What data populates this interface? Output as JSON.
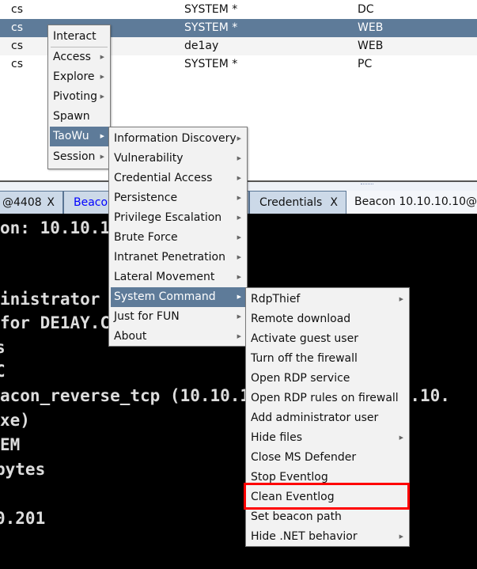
{
  "table": {
    "rows": [
      {
        "listener": "cs",
        "user": "SYSTEM *",
        "computer": "DC"
      },
      {
        "listener": "cs",
        "user": "SYSTEM *",
        "computer": "WEB",
        "selected": true
      },
      {
        "listener": "cs",
        "user": "de1ay",
        "computer": "WEB"
      },
      {
        "listener": "cs",
        "user": "SYSTEM *",
        "computer": "PC"
      }
    ]
  },
  "tabs": [
    {
      "label": "@4408",
      "close": "X"
    },
    {
      "label": "Beacon 10.10.10.80@2040",
      "close": "X"
    },
    {
      "label": "Credentials",
      "close": "X"
    },
    {
      "label": "Beacon 10.10.10.10@"
    }
  ],
  "terminal": {
    "lines": [
      "on: 10.10.10.80",
      "inistrator 1",
      "for DE1AY.COM\\administrator",
      "s",
      "C",
      "acon_reverse_tcp (10.10.10.80:4444) on 10.10.",
      "xe)",
      "EM",
      "bytes",
      "0.201"
    ]
  },
  "menu1": {
    "items": [
      "Interact",
      "Access",
      "Explore",
      "Pivoting",
      "Spawn",
      "TaoWu",
      "Session"
    ]
  },
  "menu2": {
    "items": [
      "Information Discovery",
      "Vulnerability",
      "Credential Access",
      "Persistence",
      "Privilege Escalation",
      "Brute Force",
      "Intranet Penetration",
      "Lateral Movement",
      "System Command",
      "Just for FUN",
      "About"
    ]
  },
  "menu3": {
    "items": [
      "RdpThief",
      "Remote download",
      "Activate guest user",
      "Turn off the firewall",
      "Open RDP service",
      "Open RDP rules on firewall",
      "Add administrator user",
      "Hide files",
      "Close MS Defender",
      "Stop Eventlog",
      "Clean Eventlog",
      "Set beacon path",
      "Hide .NET behavior"
    ]
  },
  "colors": {
    "selection": "#5e7b99",
    "highlight_box": "#ff0000",
    "terminal_bg": "#000000",
    "tab_link": "#0000ff"
  }
}
